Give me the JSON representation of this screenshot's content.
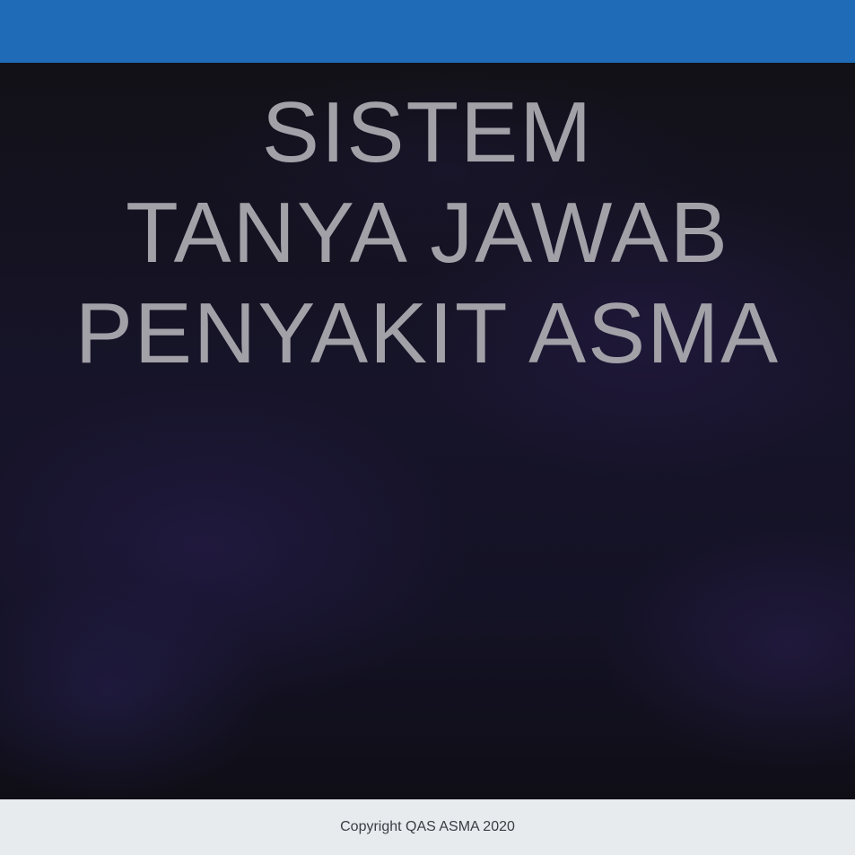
{
  "header": {
    "color": "#1f6bb7"
  },
  "hero": {
    "title_lines": [
      "SISTEM",
      "TANYA JAWAB",
      "PENYAKIT ASMA"
    ],
    "title_color": "#a3a1a8"
  },
  "footer": {
    "copyright": "Copyright QAS ASMA 2020"
  }
}
